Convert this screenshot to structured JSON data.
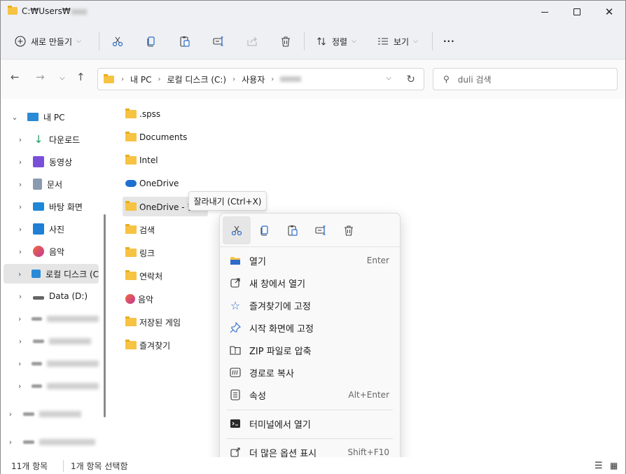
{
  "window": {
    "title": "C:₩Users₩"
  },
  "toolbar": {
    "new_label": "새로 만들기",
    "sort_label": "정렬",
    "view_label": "보기",
    "more_label": "···"
  },
  "address": {
    "crumbs": [
      "내 PC",
      "로컬 디스크 (C:)",
      "사용자"
    ],
    "search_placeholder": "duli 검색"
  },
  "sidebar": {
    "items": [
      {
        "label": "내 PC",
        "icon": "monitor-icon",
        "color": "#2b8ad6"
      },
      {
        "label": "다운로드",
        "icon": "download-icon",
        "color": "#1a9b5c"
      },
      {
        "label": "동영상",
        "icon": "video-icon",
        "color": "#7a4fd8"
      },
      {
        "label": "문서",
        "icon": "document-icon",
        "color": "#6b7c93"
      },
      {
        "label": "바탕 화면",
        "icon": "desktop-icon",
        "color": "#1e87d6"
      },
      {
        "label": "사진",
        "icon": "picture-icon",
        "color": "#1f7fd4"
      },
      {
        "label": "음악",
        "icon": "music-icon",
        "color": "#e0503c"
      },
      {
        "label": "로컬 디스크 (C",
        "icon": "windows-drive-icon",
        "color": "#2b8ad6"
      },
      {
        "label": "Data (D:)",
        "icon": "drive-icon",
        "color": "#555555"
      }
    ]
  },
  "files": [
    {
      "label": ".spss",
      "icon": "folder"
    },
    {
      "label": "Documents",
      "icon": "folder"
    },
    {
      "label": "Intel",
      "icon": "folder"
    },
    {
      "label": "OneDrive",
      "icon": "cloud"
    },
    {
      "label": "OneDrive - 한",
      "icon": "folder"
    },
    {
      "label": "검색",
      "icon": "folder"
    },
    {
      "label": "링크",
      "icon": "folder"
    },
    {
      "label": "연락처",
      "icon": "folder"
    },
    {
      "label": "음악",
      "icon": "music"
    },
    {
      "label": "저장된 게임",
      "icon": "folder"
    },
    {
      "label": "즐겨찾기",
      "icon": "folder"
    }
  ],
  "tooltip": {
    "text": "잘라내기 (Ctrl+X)"
  },
  "context_menu": {
    "items": [
      {
        "label": "열기",
        "shortcut": "Enter"
      },
      {
        "label": "새 창에서 열기",
        "shortcut": ""
      },
      {
        "label": "즐겨찾기에 고정",
        "shortcut": ""
      },
      {
        "label": "시작 화면에 고정",
        "shortcut": ""
      },
      {
        "label": "ZIP 파일로 압축",
        "shortcut": ""
      },
      {
        "label": "경로로 복사",
        "shortcut": ""
      },
      {
        "label": "속성",
        "shortcut": "Alt+Enter"
      },
      {
        "label": "터미널에서 열기",
        "shortcut": ""
      },
      {
        "label": "더 많은 옵션 표시",
        "shortcut": "Shift+F10"
      }
    ]
  },
  "status": {
    "count": "11개 항목",
    "selected": "1개 항목 선택함"
  }
}
